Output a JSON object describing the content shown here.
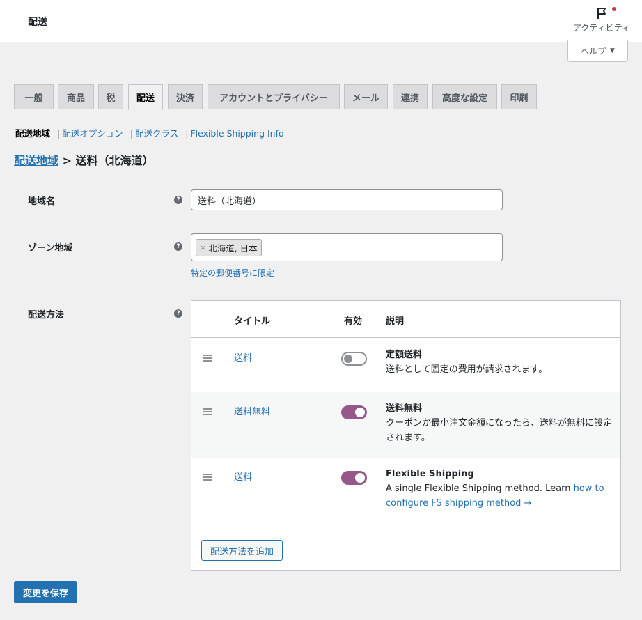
{
  "topbar": {
    "title": "配送",
    "activity_label": "アクティビティ",
    "activity_icon": "flag-icon"
  },
  "help": {
    "label": "ヘルプ",
    "caret": "▼"
  },
  "tabs": [
    "一般",
    "商品",
    "税",
    "配送",
    "決済",
    "アカウントとプライバシー",
    "メール",
    "連携",
    "高度な設定",
    "印刷"
  ],
  "active_tab": "配送",
  "subnav": {
    "current": "配送地域",
    "links": [
      "配送オプション",
      "配送クラス",
      "Flexible Shipping Info"
    ],
    "separator": "|"
  },
  "heading": {
    "link": "配送地域",
    "separator": ">",
    "title": "送料（北海道）"
  },
  "form": {
    "zone_name": {
      "label": "地域名",
      "value": "送料（北海道）"
    },
    "zone_regions": {
      "label": "ゾーン地域",
      "chips": [
        "北海道, 日本"
      ],
      "remove": "×",
      "limit_link": "特定の郵便番号に限定"
    },
    "methods_label": "配送方法"
  },
  "methods": {
    "columns": {
      "title": "タイトル",
      "enabled": "有効",
      "description": "説明"
    },
    "rows": [
      {
        "title": "送料",
        "enabled": false,
        "desc_title": "定額送料",
        "desc": "送料として固定の費用が請求されます。",
        "desc_link": ""
      },
      {
        "title": "送料無料",
        "enabled": true,
        "desc_title": "送料無料",
        "desc": "クーポンか最小注文金額になったら、送料が無料に設定されます。",
        "desc_link": ""
      },
      {
        "title": "送料",
        "enabled": true,
        "desc_title": "Flexible Shipping",
        "desc": "A single Flexible Shipping method. Learn ",
        "desc_link": "how to configure FS shipping method →"
      }
    ],
    "add_button": "配送方法を追加"
  },
  "save_button": "変更を保存",
  "colors": {
    "accent": "#2271b1",
    "toggle_on": "#96588a",
    "notification_dot": "#d63638"
  }
}
